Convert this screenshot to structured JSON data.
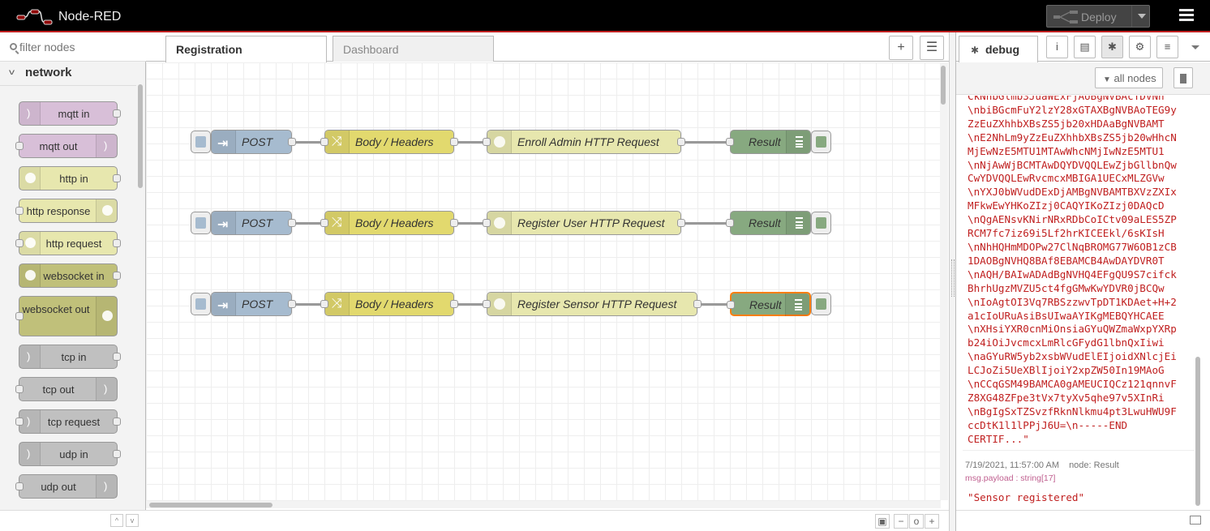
{
  "header": {
    "app_name": "Node-RED",
    "deploy_label": "Deploy"
  },
  "palette": {
    "filter_placeholder": "filter nodes",
    "category": "network",
    "nodes": [
      {
        "label": "mqtt in",
        "color": "#d8bfd8",
        "icon": "waves-icon",
        "icon_side": "left",
        "input": false,
        "output": true
      },
      {
        "label": "mqtt out",
        "color": "#d8bfd8",
        "icon": "waves-icon",
        "icon_side": "right",
        "input": true,
        "output": false
      },
      {
        "label": "http in",
        "color": "#e7e7ae",
        "icon": "globe-icon",
        "icon_side": "left",
        "input": false,
        "output": true
      },
      {
        "label": "http response",
        "color": "#e7e7ae",
        "icon": "globe-icon",
        "icon_side": "right",
        "input": true,
        "output": false
      },
      {
        "label": "http request",
        "color": "#e7e7ae",
        "icon": "globe-icon",
        "icon_side": "left",
        "input": true,
        "output": true
      },
      {
        "label": "websocket in",
        "color": "#c0c07a",
        "icon": "globe-icon",
        "icon_side": "left",
        "input": false,
        "output": true
      },
      {
        "label": "websocket out",
        "color": "#c0c07a",
        "icon": "globe-icon",
        "icon_side": "right",
        "input": true,
        "output": false
      },
      {
        "label": "tcp in",
        "color": "#c0c0c0",
        "icon": "waves-icon",
        "icon_side": "left",
        "input": false,
        "output": true
      },
      {
        "label": "tcp out",
        "color": "#c0c0c0",
        "icon": "waves-icon",
        "icon_side": "right",
        "input": true,
        "output": false
      },
      {
        "label": "tcp request",
        "color": "#c0c0c0",
        "icon": "waves-icon",
        "icon_side": "left",
        "input": true,
        "output": true
      },
      {
        "label": "udp in",
        "color": "#c0c0c0",
        "icon": "waves-icon",
        "icon_side": "left",
        "input": false,
        "output": true
      },
      {
        "label": "udp out",
        "color": "#c0c0c0",
        "icon": "waves-icon",
        "icon_side": "right",
        "input": true,
        "output": false
      }
    ]
  },
  "workspace": {
    "tabs": [
      {
        "label": "Registration",
        "active": true
      },
      {
        "label": "Dashboard",
        "active": false
      }
    ],
    "flows": [
      {
        "inject": "POST",
        "change": "Body / Headers",
        "request": "Enroll Admin HTTP Request",
        "debug": "Result",
        "selected": false
      },
      {
        "inject": "POST",
        "change": "Body / Headers",
        "request": "Register User HTTP Request",
        "debug": "Result",
        "selected": false
      },
      {
        "inject": "POST",
        "change": "Body / Headers",
        "request": "Register Sensor HTTP Request",
        "debug": "Result",
        "selected": true
      }
    ],
    "colors": {
      "inject": "#a6bbcf",
      "change": "#e2d96e",
      "http_request": "#e7e7ae",
      "debug": "#87a980",
      "selected_outline": "#ff7f0e"
    }
  },
  "sidebar": {
    "active_tab": "debug",
    "filter_label": "all nodes",
    "cert_text": "CkNhbGlmb3JuaWExFjAUBgNVBAcTDVNh\n\\nbiBGcmFuY2lzY28xGTAXBgNVBAoTEG9y\nZzEuZXhhbXBsZS5jb20xHDAaBgNVBAMT\n\\nE2NhLm9yZzEuZXhhbXBsZS5jb20wHhcN\nMjEwNzE5MTU1MTAwWhcNMjIwNzE5MTU1\n\\nNjAwWjBCMTAwDQYDVQQLEwZjbGllbnQw\nCwYDVQQLEwRvcmcxMBIGA1UECxMLZGVw\n\\nYXJ0bWVudDExDjAMBgNVBAMTBXVzZXIx\nMFkwEwYHKoZIzj0CAQYIKoZIzj0DAQcD\n\\nQgAENsvKNirNRxRDbCoICtv09aLES5ZP\nRCM7fc7iz69i5Lf2hrKICEEkl/6sKIsH\n\\nNhHQHmMDOPw27ClNqBROMG77W6OB1zCB\n1DAOBgNVHQ8BAf8EBAMCB4AwDAYDVR0T\n\\nAQH/BAIwADAdBgNVHQ4EFgQU9S7cifck\nBhrhUgzMVZU5ct4fgGMwKwYDVR0jBCQw\n\\nIoAgtOI3Vq7RBSzzwvTpDT1KDAet+H+2\na1cIoURuAsiBsUIwaAYIKgMEBQYHCAEE\n\\nXHsiYXR0cnMiOnsiaGYuQWZmaWxpYXRp\nb24iOiJvcmcxLmRlcGFydG1lbnQxIiwi\n\\naGYuRW5yb2xsbWVudElEIjoidXNlcjEi\nLCJoZi5UeXBlIjoiY2xpZW50In19MAoG\n\\nCCqGSM49BAMCA0gAMEUCIQCz121qnnvF\nZ8XG48ZFpe3tVx7tyXv5qhe97v5XInRi\n\\nBgIgSxTZSvzfRknNlkmu4pt3LwuHWU9F\nccDtK1l1lPPjJ6U=\\n-----END\nCERTIF...\"",
    "msg_timestamp": "7/19/2021, 11:57:00 AM",
    "msg_node": "node: Result",
    "msg_type": "msg.payload : string[17]",
    "msg_value": "\"Sensor registered\""
  }
}
